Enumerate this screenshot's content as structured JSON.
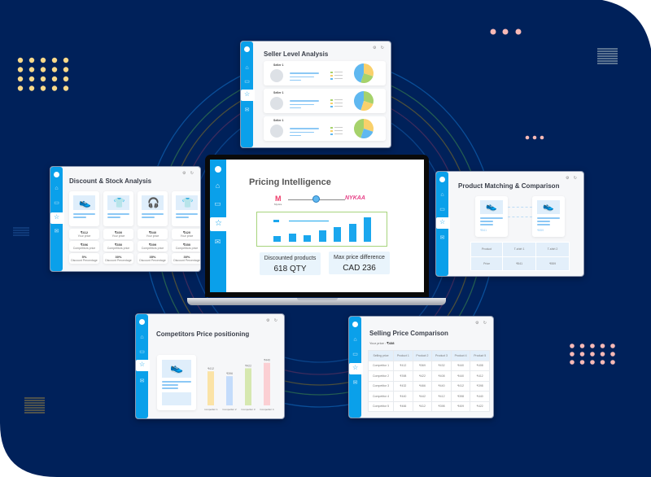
{
  "colors": {
    "background": "#00215a",
    "sidebar": "#0aa0ea",
    "accent_blue": "#1aa7ee",
    "chart_border": "#9fd26b",
    "dots_yellow": "#f9d98a",
    "dots_pink": "#f7b9b6"
  },
  "sidebar_icons": [
    "home-icon",
    "folder-icon",
    "star-icon",
    "mail-icon"
  ],
  "window_tools": "⚙ ↻",
  "seller_panel": {
    "title": "Seller Level Analysis",
    "rows": [
      {
        "label": "Seller 1",
        "pie": [
          "Brand",
          "Range",
          "Description"
        ]
      },
      {
        "label": "Seller 1",
        "pie": [
          "Rating",
          "Description",
          "Rating"
        ]
      },
      {
        "label": "Seller 1",
        "pie": [
          "Brand",
          "Range",
          "Description"
        ]
      }
    ]
  },
  "pricing_panel": {
    "title": "Pricing Intelligence",
    "logo_left": "Myntra",
    "logo_right": "NYKAA",
    "bars": [
      0.22,
      0.3,
      0.24,
      0.42,
      0.52,
      0.66,
      0.88
    ],
    "stats": [
      {
        "label": "Discounted products",
        "value": "618 QTY"
      },
      {
        "label": "Max price difference",
        "value": "CAD 236"
      }
    ]
  },
  "discount_panel": {
    "title": "Discount & Stock Analysis",
    "products": [
      {
        "icon": "shoe-icon",
        "your_price": "₹412",
        "competitor_price": "₹396",
        "discount": "5%"
      },
      {
        "icon": "tshirt-icon",
        "your_price": "₹400",
        "competitor_price": "₹350",
        "discount": "30%"
      },
      {
        "icon": "headphones-icon",
        "your_price": "₹540",
        "competitor_price": "₹399",
        "discount": "35%"
      },
      {
        "icon": "tshirt-icon",
        "your_price": "₹420",
        "competitor_price": "₹350",
        "discount": "30%"
      }
    ],
    "your_price_label": "Your price",
    "competitor_label": "Competitors price",
    "discount_label": "Discount Percentage"
  },
  "matching_panel": {
    "title": "Product Matching & Comparison",
    "card_prices": [
      "₹541",
      "₹559"
    ],
    "table": [
      [
        "Product",
        "T-shirt 1",
        "T-shirt 2"
      ],
      [
        "Price",
        "₹541",
        "₹559"
      ]
    ]
  },
  "competitor_panel": {
    "title": "Competitors Price positioning",
    "chart_data": {
      "type": "bar",
      "categories": [
        "Competitor 1",
        "Competitor 2",
        "Competitor 3",
        "Competitor 4"
      ],
      "values": [
        412,
        396,
        422,
        440
      ],
      "value_labels": [
        "₹412",
        "₹396",
        "₹422",
        "₹440"
      ],
      "colors": [
        "#fbe3a6",
        "#c4dcfb",
        "#d6e8b0",
        "#fbcfd3"
      ]
    }
  },
  "selling_panel": {
    "title": "Selling Price Comparison",
    "your_price_label": "Your price :",
    "your_price": "₹438",
    "headers": [
      "Selling price",
      "Product 1",
      "Product 2",
      "Product 3",
      "Product 4",
      "Product 5"
    ],
    "rows": [
      [
        "Competitor 1",
        "₹412",
        "₹369",
        "₹432",
        "₹440",
        "₹408"
      ],
      [
        "Competitor 2",
        "₹398",
        "₹422",
        "₹408",
        "₹440",
        "₹412"
      ],
      [
        "Competitor 3",
        "₹432",
        "₹466",
        "₹440",
        "₹412",
        "₹398"
      ],
      [
        "Competitor 4",
        "₹440",
        "₹442",
        "₹412",
        "₹398",
        "₹440"
      ],
      [
        "Competitor 5",
        "₹466",
        "₹412",
        "₹398",
        "₹409",
        "₹422"
      ]
    ]
  }
}
